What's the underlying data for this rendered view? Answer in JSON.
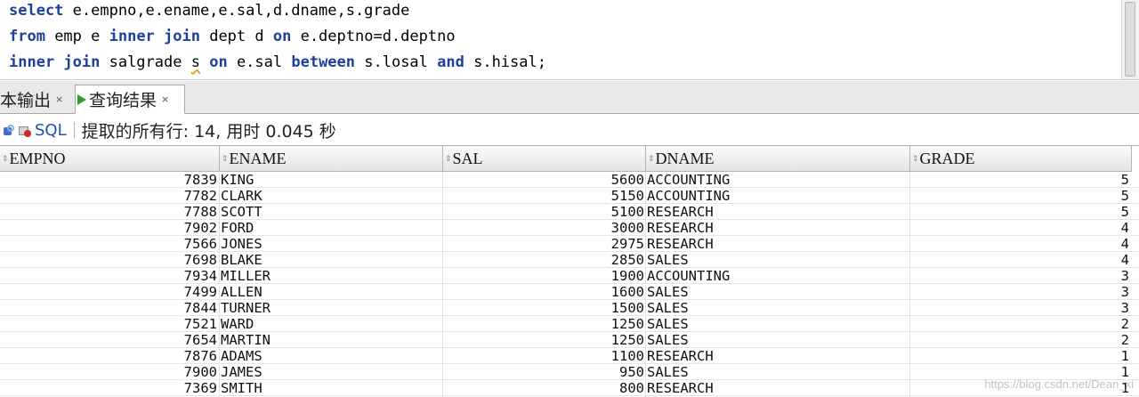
{
  "editor": {
    "lines": [
      [
        {
          "t": "select",
          "kw": true
        },
        {
          "t": " e.empno,e.ename,e.sal,d.dname,s.grade",
          "kw": false
        }
      ],
      [
        {
          "t": "from",
          "kw": true
        },
        {
          "t": " emp e ",
          "kw": false
        },
        {
          "t": "inner join",
          "kw": true
        },
        {
          "t": " dept d ",
          "kw": false
        },
        {
          "t": "on",
          "kw": true
        },
        {
          "t": " e.deptno=d.deptno",
          "kw": false
        }
      ],
      [
        {
          "t": "inner join",
          "kw": true
        },
        {
          "t": " salgrade ",
          "kw": false
        },
        {
          "t": "s",
          "kw": false,
          "squiggle": true
        },
        {
          "t": " ",
          "kw": false
        },
        {
          "t": "on",
          "kw": true
        },
        {
          "t": " e.sal ",
          "kw": false
        },
        {
          "t": "between",
          "kw": true
        },
        {
          "t": " s.losal ",
          "kw": false
        },
        {
          "t": "and",
          "kw": true
        },
        {
          "t": " s.hisal;",
          "kw": false
        }
      ]
    ]
  },
  "tabs": {
    "script_output": "本输出",
    "query_result": "查询结果",
    "close_glyph": "×"
  },
  "toolbar": {
    "sql_label": "SQL",
    "status": "提取的所有行: 14, 用时 0.045 秒"
  },
  "grid": {
    "columns": [
      "EMPNO",
      "ENAME",
      "SAL",
      "DNAME",
      "GRADE"
    ],
    "sort_glyph": "⇕",
    "rows": [
      [
        "7839",
        "KING",
        "5600",
        "ACCOUNTING",
        "5"
      ],
      [
        "7782",
        "CLARK",
        "5150",
        "ACCOUNTING",
        "5"
      ],
      [
        "7788",
        "SCOTT",
        "5100",
        "RESEARCH",
        "5"
      ],
      [
        "7902",
        "FORD",
        "3000",
        "RESEARCH",
        "4"
      ],
      [
        "7566",
        "JONES",
        "2975",
        "RESEARCH",
        "4"
      ],
      [
        "7698",
        "BLAKE",
        "2850",
        "SALES",
        "4"
      ],
      [
        "7934",
        "MILLER",
        "1900",
        "ACCOUNTING",
        "3"
      ],
      [
        "7499",
        "ALLEN",
        "1600",
        "SALES",
        "3"
      ],
      [
        "7844",
        "TURNER",
        "1500",
        "SALES",
        "3"
      ],
      [
        "7521",
        "WARD",
        "1250",
        "SALES",
        "2"
      ],
      [
        "7654",
        "MARTIN",
        "1250",
        "SALES",
        "2"
      ],
      [
        "7876",
        "ADAMS",
        "1100",
        "RESEARCH",
        "1"
      ],
      [
        "7900",
        "JAMES",
        "950",
        "SALES",
        "1"
      ],
      [
        "7369",
        "SMITH",
        "800",
        "RESEARCH",
        "1"
      ]
    ]
  },
  "watermark": "https://blog.csdn.net/Dean_xi",
  "colors": {
    "keyword": "#1f3f9f",
    "run_icon": "#27a627",
    "sql_link": "#1f4fb4"
  }
}
